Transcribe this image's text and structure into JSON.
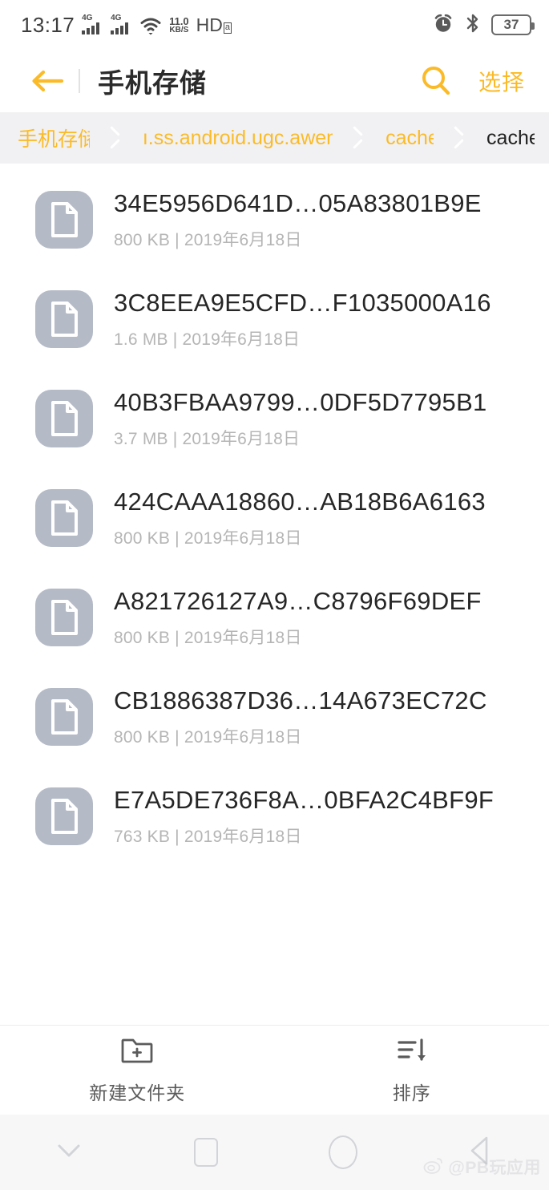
{
  "statusbar": {
    "time": "13:17",
    "signal1_label": "4G",
    "signal2_label": "4G",
    "wifi_icon": "wifi-icon",
    "network_speed_value": "11.0",
    "network_speed_unit": "KB/S",
    "hd_label": "HD",
    "hd_sub": "a",
    "alarm_icon": "alarm-clock-icon",
    "bluetooth_icon": "bluetooth-icon",
    "battery_level": "37"
  },
  "appbar": {
    "back_icon": "back-arrow-icon",
    "title": "手机存储",
    "search_icon": "search-icon",
    "select_label": "选择"
  },
  "breadcrumb": {
    "items": [
      {
        "label": "手机存储",
        "current": false
      },
      {
        "label": "ı.ss.android.ugc.aweme",
        "current": false
      },
      {
        "label": "cache",
        "current": false
      },
      {
        "label": "cache",
        "current": true
      }
    ]
  },
  "files": [
    {
      "name": "34E5956D641D…05A83801B9E",
      "size": "800 KB",
      "date": "2019年6月18日",
      "icon": "document-file-icon"
    },
    {
      "name": "3C8EEA9E5CFD…F1035000A16",
      "size": "1.6 MB",
      "date": "2019年6月18日",
      "icon": "document-file-icon"
    },
    {
      "name": "40B3FBAA9799…0DF5D7795B1",
      "size": "3.7 MB",
      "date": "2019年6月18日",
      "icon": "document-file-icon"
    },
    {
      "name": "424CAAA18860…AB18B6A6163",
      "size": "800 KB",
      "date": "2019年6月18日",
      "icon": "document-file-icon"
    },
    {
      "name": "A821726127A9…C8796F69DEF",
      "size": "800 KB",
      "date": "2019年6月18日",
      "icon": "document-file-icon"
    },
    {
      "name": "CB1886387D36…14A673EC72C",
      "size": "800 KB",
      "date": "2019年6月18日",
      "icon": "document-file-icon"
    },
    {
      "name": "E7A5DE736F8A…0BFA2C4BF9F",
      "size": "763 KB",
      "date": "2019年6月18日",
      "icon": "document-file-icon"
    }
  ],
  "file_meta_separator": " | ",
  "toolbar": {
    "new_folder_label": "新建文件夹",
    "new_folder_icon": "folder-plus-icon",
    "sort_label": "排序",
    "sort_icon": "sort-descending-icon"
  },
  "navbar": {
    "hide_icon": "chevron-down-icon",
    "recents_icon": "square-recents-icon",
    "home_icon": "circle-home-icon",
    "back_icon": "triangle-back-icon"
  },
  "watermark": {
    "logo_icon": "weibo-logo-icon",
    "text": "@PB玩应用"
  },
  "colors": {
    "accent": "#FBBB28",
    "breadcrumb_bg": "#F1F1F3",
    "file_icon_bg": "#B4BAC6",
    "title": "#2B2B2B",
    "meta": "#B5B5B5"
  }
}
